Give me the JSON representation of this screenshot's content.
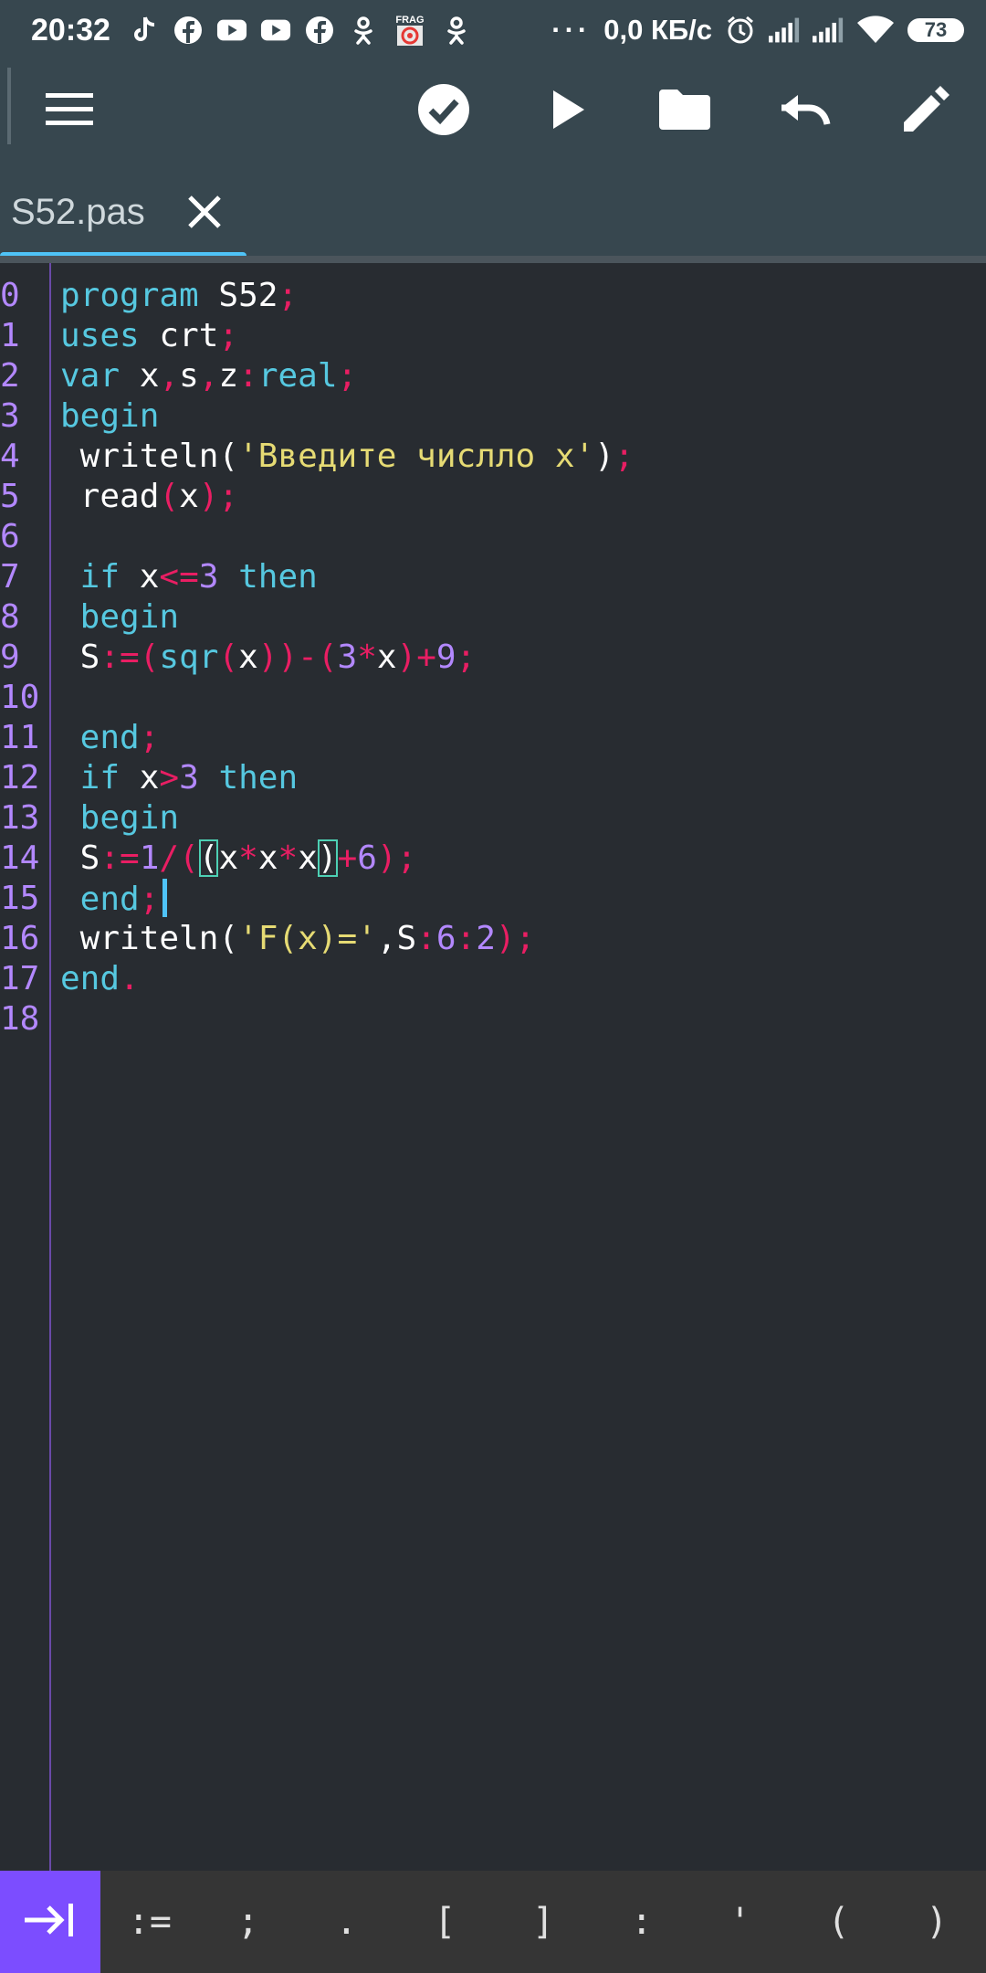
{
  "status": {
    "time": "20:32",
    "speed": "0,0 КБ/с",
    "battery": "73",
    "notif_badge": "FRAG"
  },
  "colors": {
    "bar": "#37474f",
    "editor_bg": "#282c31",
    "keyword": "#56c8e0",
    "punct": "#e91e63",
    "number": "#b388ff",
    "string": "#e6db74",
    "accent": "#7c4dff",
    "tab_indicator": "#4fc3f7"
  },
  "toolbar": {
    "icons": [
      "menu-icon",
      "check-icon",
      "play-icon",
      "folder-icon",
      "undo-icon",
      "edit-icon"
    ]
  },
  "tab": {
    "label": "S52.pas"
  },
  "code_lines": [
    {
      "n": "0",
      "tokens": [
        [
          "kw",
          "program"
        ],
        [
          "id",
          " S52"
        ],
        [
          "pu",
          ";"
        ]
      ]
    },
    {
      "n": "1",
      "tokens": [
        [
          "kw",
          "uses"
        ],
        [
          "id",
          " crt"
        ],
        [
          "pu",
          ";"
        ]
      ]
    },
    {
      "n": "2",
      "tokens": [
        [
          "kw",
          "var"
        ],
        [
          "id",
          " x"
        ],
        [
          "pu",
          ","
        ],
        [
          "id",
          "s"
        ],
        [
          "pu",
          ","
        ],
        [
          "id",
          "z"
        ],
        [
          "pu",
          ":"
        ],
        [
          "kw",
          "real"
        ],
        [
          "pu",
          ";"
        ]
      ]
    },
    {
      "n": "3",
      "tokens": [
        [
          "kw",
          "begin"
        ]
      ]
    },
    {
      "n": "4",
      "tokens": [
        [
          "id",
          " writeln("
        ],
        [
          "st",
          "'Введите числло x'"
        ],
        [
          "id",
          ")"
        ],
        [
          "pu",
          ";"
        ]
      ]
    },
    {
      "n": "5",
      "tokens": [
        [
          "id",
          " read"
        ],
        [
          "pu",
          "("
        ],
        [
          "id",
          "x"
        ],
        [
          "pu",
          ");"
        ]
      ]
    },
    {
      "n": "6",
      "tokens": []
    },
    {
      "n": "7",
      "tokens": [
        [
          "kw",
          " if"
        ],
        [
          "id",
          " x"
        ],
        [
          "pu",
          "<="
        ],
        [
          "nu",
          "3"
        ],
        [
          "kw",
          " then"
        ]
      ]
    },
    {
      "n": "8",
      "tokens": [
        [
          "kw",
          " begin"
        ]
      ]
    },
    {
      "n": "9",
      "tokens": [
        [
          "id",
          " S"
        ],
        [
          "pu",
          ":=("
        ],
        [
          "kw",
          "sqr"
        ],
        [
          "pu",
          "("
        ],
        [
          "id",
          "x"
        ],
        [
          "pu",
          "))-("
        ],
        [
          "nu",
          "3"
        ],
        [
          "pu",
          "*"
        ],
        [
          "id",
          "x"
        ],
        [
          "pu",
          ")+"
        ],
        [
          "nu",
          "9"
        ],
        [
          "pu",
          ";"
        ]
      ]
    },
    {
      "n": "10",
      "tokens": []
    },
    {
      "n": "11",
      "tokens": [
        [
          "kw",
          " end"
        ],
        [
          "pu",
          ";"
        ]
      ]
    },
    {
      "n": "12",
      "tokens": [
        [
          "kw",
          " if"
        ],
        [
          "id",
          " x"
        ],
        [
          "pu",
          ">"
        ],
        [
          "nu",
          "3"
        ],
        [
          "kw",
          " then"
        ]
      ]
    },
    {
      "n": "13",
      "tokens": [
        [
          "kw",
          " begin"
        ]
      ]
    },
    {
      "n": "14",
      "tokens": [
        [
          "id",
          " S"
        ],
        [
          "pu",
          ":="
        ],
        [
          "nu",
          "1"
        ],
        [
          "pu",
          "/("
        ],
        [
          "br",
          "("
        ],
        [
          "id",
          "x"
        ],
        [
          "pu",
          "*"
        ],
        [
          "id",
          "x"
        ],
        [
          "pu",
          "*"
        ],
        [
          "id",
          "x"
        ],
        [
          "br",
          ")"
        ],
        [
          "pu",
          "+"
        ],
        [
          "nu",
          "6"
        ],
        [
          "pu",
          ");"
        ]
      ]
    },
    {
      "n": "15",
      "tokens": [
        [
          "kw",
          " end"
        ],
        [
          "pu",
          ";"
        ],
        [
          "cursor",
          ""
        ]
      ]
    },
    {
      "n": "16",
      "tokens": [
        [
          "id",
          " writeln("
        ],
        [
          "st",
          "'F(x)='"
        ],
        [
          "id",
          ",S"
        ],
        [
          "pu",
          ":"
        ],
        [
          "nu",
          "6"
        ],
        [
          "pu",
          ":"
        ],
        [
          "nu",
          "2"
        ],
        [
          "pu",
          ");"
        ]
      ]
    },
    {
      "n": "17",
      "tokens": [
        [
          "kw",
          "end"
        ],
        [
          "pu",
          "."
        ]
      ]
    },
    {
      "n": "18",
      "tokens": []
    }
  ],
  "keybar": {
    "keys": [
      ":=",
      ";",
      ".",
      "[",
      "]",
      ":",
      "'",
      "(",
      ")"
    ]
  }
}
